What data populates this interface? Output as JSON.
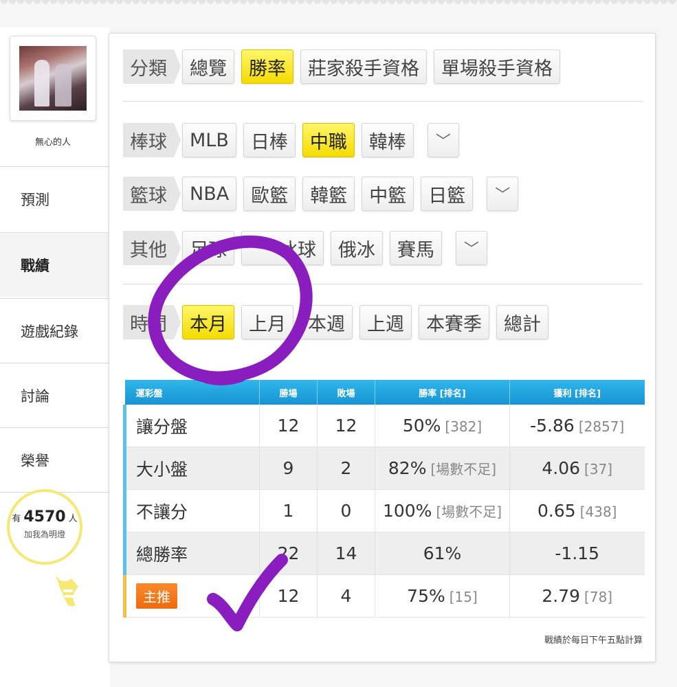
{
  "user": {
    "name": "無心的人"
  },
  "sidebar": {
    "items": [
      {
        "label": "預測"
      },
      {
        "label": "戰績"
      },
      {
        "label": "遊戲紀錄"
      },
      {
        "label": "討論"
      },
      {
        "label": "榮譽"
      }
    ],
    "fans_prefix": "有",
    "fans_count": "4570",
    "fans_suffix": "人",
    "fans_cta": "加我為明燈"
  },
  "filters": {
    "category": {
      "label": "分類",
      "options": [
        "總覽",
        "勝率",
        "莊家殺手資格",
        "單場殺手資格"
      ],
      "selected": "勝率"
    },
    "baseball": {
      "label": "棒球",
      "options": [
        "MLB",
        "日棒",
        "中職",
        "韓棒"
      ],
      "selected": "中職"
    },
    "basketball": {
      "label": "籃球",
      "options": [
        "NBA",
        "歐籃",
        "韓籃",
        "中籃",
        "日籃"
      ]
    },
    "other": {
      "label": "其他",
      "options": [
        "足球",
        "冰球",
        "俄冰",
        "賽馬"
      ]
    },
    "time": {
      "label": "時間",
      "options": [
        "本月",
        "上月",
        "本週",
        "上週",
        "本賽季",
        "總計"
      ],
      "selected": "本月"
    },
    "expand_icon": "chevron-down-icon"
  },
  "table": {
    "headers": [
      "運彩盤",
      "勝場",
      "敗場",
      "勝率 [排名]",
      "獲利 [排名]"
    ],
    "rows": [
      {
        "type": "讓分盤",
        "wins": "12",
        "losses": "12",
        "rate": "50%",
        "rate_rank": "[382]",
        "profit": "-5.86",
        "profit_rank": "[2857]"
      },
      {
        "type": "大小盤",
        "wins": "9",
        "losses": "2",
        "rate": "82%",
        "rate_rank": "[場數不足]",
        "profit": "4.06",
        "profit_rank": "[37]"
      },
      {
        "type": "不讓分",
        "wins": "1",
        "losses": "0",
        "rate": "100%",
        "rate_rank": "[場數不足]",
        "profit": "0.65",
        "profit_rank": "[438]"
      },
      {
        "type": "總勝率",
        "wins": "22",
        "losses": "14",
        "rate": "61%",
        "rate_rank": "",
        "profit": "-1.15",
        "profit_rank": ""
      },
      {
        "type": "主推",
        "wins": "12",
        "losses": "4",
        "rate": "75%",
        "rate_rank": "[15]",
        "profit": "2.79",
        "profit_rank": "[78]"
      }
    ],
    "note": "戰績於每日下午五點計算"
  },
  "colors": {
    "selected": "#f4dc00",
    "header": "#1794d3",
    "badge": "#ef6a0e",
    "annotation": "#8a1dbd"
  }
}
